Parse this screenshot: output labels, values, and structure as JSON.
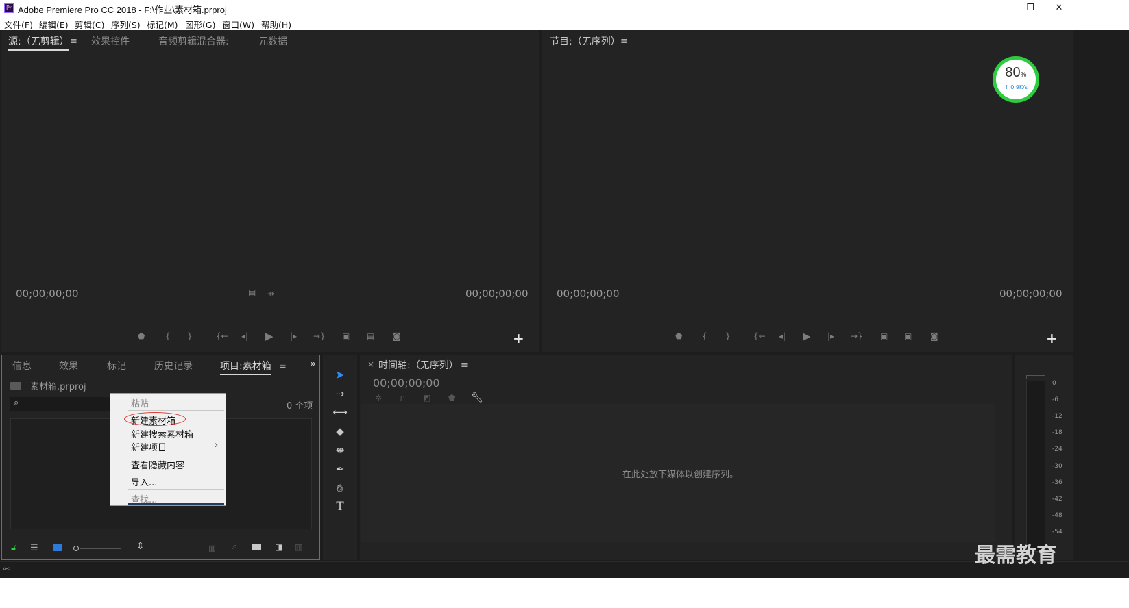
{
  "window": {
    "app_icon": "Pr",
    "title": "Adobe Premiere Pro CC 2018 - F:\\作业\\素材箱.prproj",
    "minimize": "—",
    "maximize": "❐",
    "close": "✕"
  },
  "menu": [
    "文件(F)",
    "编辑(E)",
    "剪辑(C)",
    "序列(S)",
    "标记(M)",
    "图形(G)",
    "窗口(W)",
    "帮助(H)"
  ],
  "source_panel": {
    "tabs": [
      "源:（无剪辑）",
      "效果控件",
      "音频剪辑混合器:",
      "元数据"
    ],
    "menu_icon": "≡",
    "timecode_left": "00;00;00;00",
    "timecode_right": "00;00;00;00"
  },
  "program_panel": {
    "tab": "节目:（无序列）",
    "menu_icon": "≡",
    "timecode_left": "00;00;00;00",
    "timecode_right": "00;00;00;00"
  },
  "speed_widget": {
    "percent": "80",
    "unit": "%",
    "rate": "↑ 0.9K/s",
    "color": "#2ecc40"
  },
  "project_panel": {
    "tabs": [
      "信息",
      "效果",
      "标记",
      "历史记录",
      "项目:素材箱"
    ],
    "menu_icon": "≡",
    "overflow": "»",
    "project_name": "素材箱.prproj",
    "item_count": "0 个项"
  },
  "context_menu": {
    "items": [
      "粘贴",
      "新建素材箱",
      "新建搜索素材箱",
      "新建项目",
      "查看隐藏内容",
      "导入...",
      "查找..."
    ],
    "submenu_arrow": "›",
    "highlight_color": "#d9342b"
  },
  "timeline_panel": {
    "close": "×",
    "title": "时间轴:（无序列）",
    "menu_icon": "≡",
    "timecode": "00;00;00;00",
    "empty_message": "在此处放下媒体以创建序列。"
  },
  "audio_meter": {
    "labels": [
      "0",
      "-6",
      "-12",
      "-18",
      "-24",
      "-30",
      "-36",
      "-42",
      "-48",
      "-54"
    ]
  },
  "watermark": "最需教育",
  "accent": "#2e7ad9"
}
